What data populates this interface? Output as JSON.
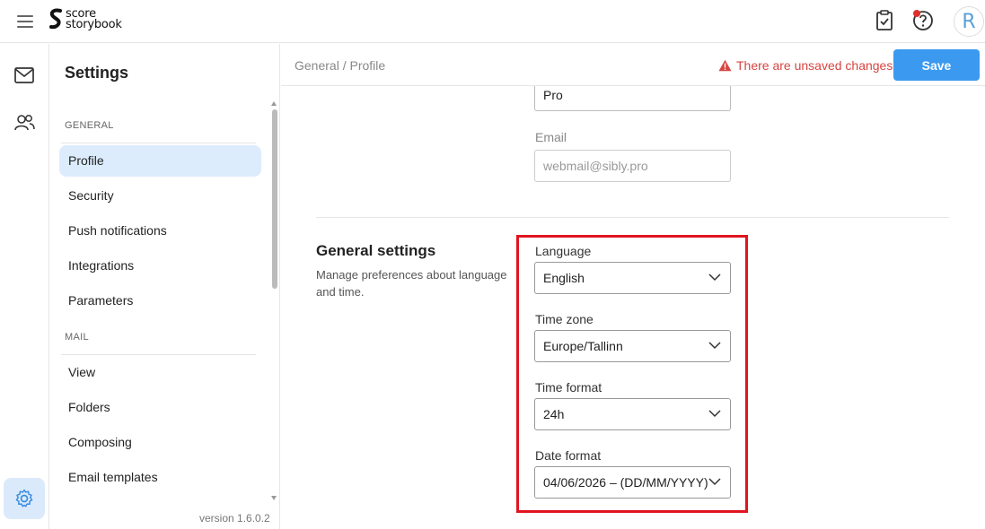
{
  "app": {
    "logo_line1": "score",
    "logo_line2": "storybook",
    "avatar_letter": "R",
    "brand_color": "#3b9af0"
  },
  "topbar": {
    "icons": [
      "menu-icon",
      "clipboard-check-icon",
      "help-icon",
      "notification-dot"
    ]
  },
  "rail": {
    "icons": [
      "mail-icon",
      "users-icon",
      "gear-icon"
    ]
  },
  "sidebar": {
    "title": "Settings",
    "sections": [
      {
        "label": "GENERAL",
        "items": [
          "Profile",
          "Security",
          "Push notifications",
          "Integrations",
          "Parameters"
        ]
      },
      {
        "label": "MAIL",
        "items": [
          "View",
          "Folders",
          "Composing",
          "Email templates"
        ]
      }
    ],
    "active_item": "Profile",
    "version": "version 1.6.0.2"
  },
  "header": {
    "breadcrumb": "General / Profile",
    "unsaved_text": "There are unsaved changes",
    "save_label": "Save"
  },
  "profile": {
    "partial_value": "Pro",
    "email_label": "Email",
    "email_value": "webmail@sibly.pro"
  },
  "general_settings": {
    "title": "General settings",
    "description": "Manage preferences about language and time.",
    "language_label": "Language",
    "language_value": "English",
    "timezone_label": "Time zone",
    "timezone_value": "Europe/Tallinn",
    "timeformat_label": "Time format",
    "timeformat_value": "24h",
    "dateformat_label": "Date format",
    "dateformat_value": "04/06/2026 – (DD/MM/YYYY)"
  }
}
